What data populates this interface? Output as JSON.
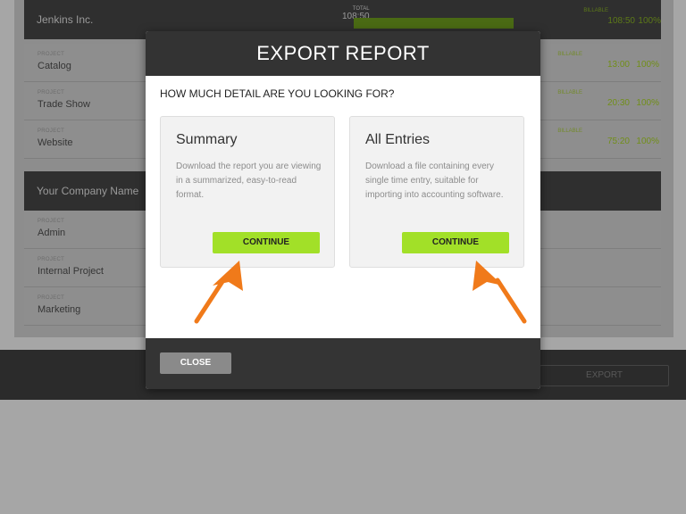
{
  "background": {
    "group1": {
      "name": "Jenkins Inc.",
      "total_label": "TOTAL",
      "total_value": "108:50",
      "billable_label": "BILLABLE",
      "billable_value": "108:50",
      "billable_percent": "100%",
      "rows": [
        {
          "label": "PROJECT",
          "name": "Catalog",
          "billable_label": "BILLABLE",
          "billable_value": "13:00",
          "billable_percent": "100%"
        },
        {
          "label": "PROJECT",
          "name": "Trade Show",
          "billable_label": "BILLABLE",
          "billable_value": "20:30",
          "billable_percent": "100%"
        },
        {
          "label": "PROJECT",
          "name": "Website",
          "billable_label": "BILLABLE",
          "billable_value": "75:20",
          "billable_percent": "100%"
        }
      ]
    },
    "group2": {
      "name": "Your Company Name",
      "rows": [
        {
          "label": "PROJECT",
          "name": "Admin"
        },
        {
          "label": "PROJECT",
          "name": "Internal Project"
        },
        {
          "label": "PROJECT",
          "name": "Marketing"
        }
      ]
    },
    "export_label": "EXPORT"
  },
  "modal": {
    "title": "EXPORT REPORT",
    "question": "HOW MUCH DETAIL ARE YOU LOOKING FOR?",
    "options": [
      {
        "title": "Summary",
        "description": "Download the report you are viewing in a summarized, easy-to-read format.",
        "button": "CONTINUE"
      },
      {
        "title": "All Entries",
        "description": "Download a file containing every single time entry, suitable for importing into accounting software.",
        "button": "CONTINUE"
      }
    ],
    "close_label": "CLOSE"
  },
  "colors": {
    "accent": "#a2e028",
    "header": "#333333",
    "arrow": "#f07a1a"
  }
}
